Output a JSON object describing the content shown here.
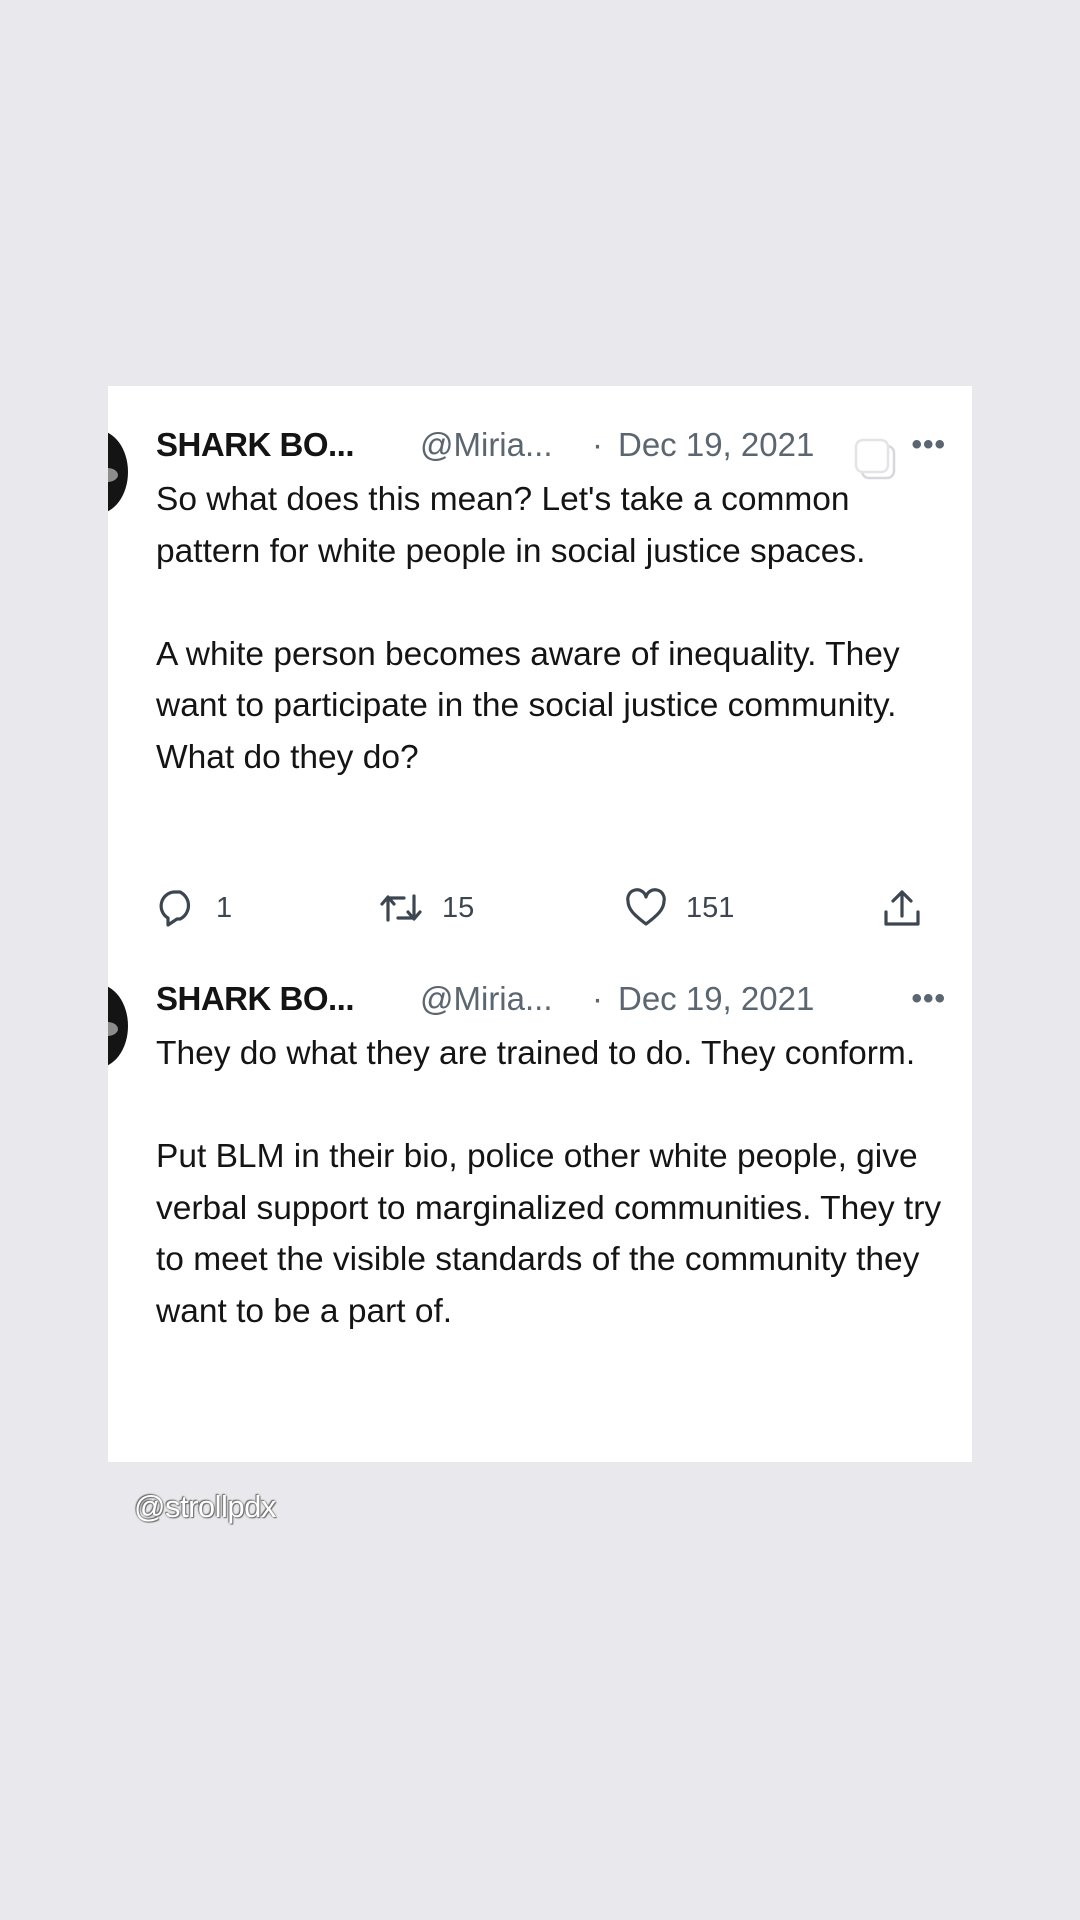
{
  "tweets": [
    {
      "author_name": "SHARK BO...",
      "handle": "@Miria...",
      "separator": "·",
      "date": "Dec 19, 2021",
      "more": "•••",
      "paragraphs": [
        "So what does this mean? Let's take a common pattern for white people in social justice spaces.",
        "A white person becomes aware of inequality. They want to participate in the social justice community. What do they do?"
      ],
      "replies": "1",
      "retweets": "15",
      "likes": "151"
    },
    {
      "author_name": "SHARK BO...",
      "handle": "@Miria...",
      "separator": "·",
      "date": "Dec 19, 2021",
      "more": "•••",
      "paragraphs": [
        "They do what they are trained to do. They conform.",
        "Put BLM in their bio, police other white people, give verbal support to marginalized communities. They try to meet the visible standards of the community they want to be a part of."
      ]
    }
  ],
  "watermark": "@strollpdx",
  "icons": {
    "reply": "reply-icon",
    "retweet": "retweet-icon",
    "like": "heart-icon",
    "share": "share-icon",
    "more": "more-icon",
    "overlay": "copy-icon"
  }
}
